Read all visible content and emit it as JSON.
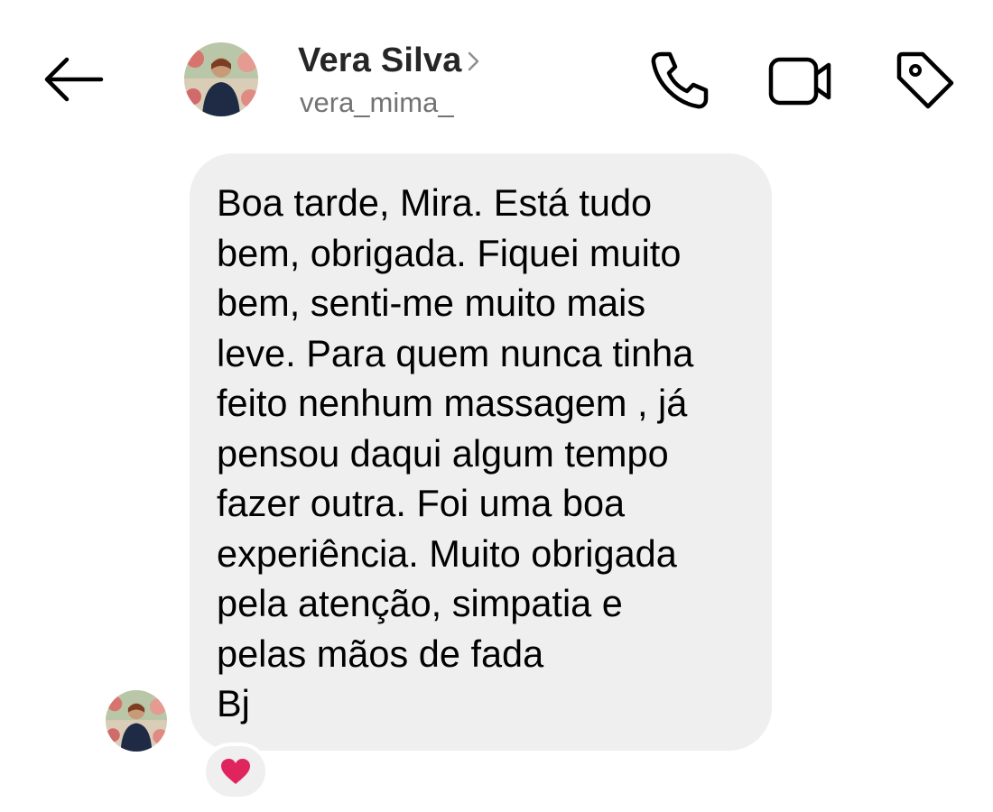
{
  "header": {
    "back_icon": "arrow-left-icon",
    "name": "Vera Silva",
    "username": "vera_mima_",
    "chevron_icon": "chevron-right-icon",
    "icons": [
      "phone-icon",
      "video-camera-icon",
      "tag-icon"
    ]
  },
  "conversation": {
    "message": "Boa tarde, Mira. Está tudo\nbem, obrigada. Fiquei muito\nbem, senti-me muito mais\nleve. Para quem nunca tinha\nfeito nenhum massagem , já\npensou daqui algum tempo\nfazer outra. Foi uma boa\nexperiência. Muito obrigada\npela atenção, simpatia e\npelas mãos de fada\nBj",
    "reaction": "heart-icon"
  },
  "colors": {
    "bubble": "#efefef",
    "username": "#737373",
    "heart": "#e0245e"
  }
}
